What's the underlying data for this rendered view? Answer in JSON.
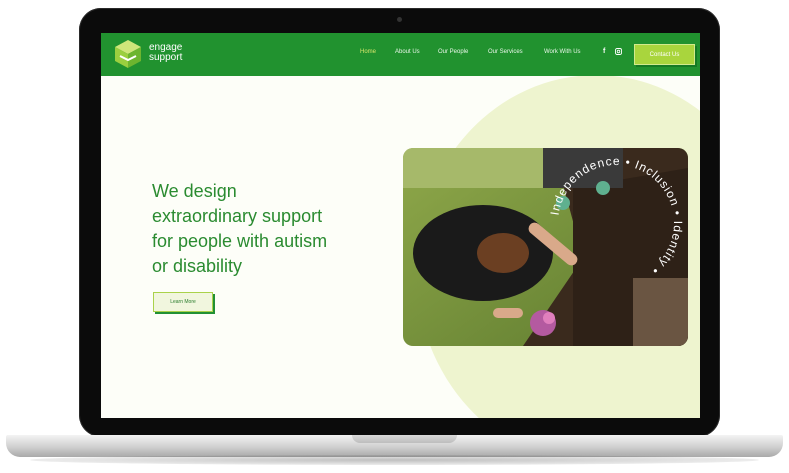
{
  "brand": {
    "line1": "engage",
    "line2": "support"
  },
  "nav": {
    "items": [
      {
        "label": "Home",
        "active": true
      },
      {
        "label": "About Us",
        "active": false
      },
      {
        "label": "Our People",
        "active": false
      },
      {
        "label": "Our Services",
        "active": false
      },
      {
        "label": "Work With Us",
        "active": false
      }
    ],
    "social": [
      "facebook-icon",
      "instagram-icon"
    ],
    "contact_label": "Contact Us"
  },
  "hero": {
    "headline_lines": [
      "We design",
      "extraordinary support",
      "for people with autism",
      "or disability"
    ],
    "cta_label": "Learn More"
  },
  "photo_ring": {
    "text": "Independence • Inclusion • Identity •"
  },
  "colors": {
    "nav_green": "#21922f",
    "accent_lime": "#a9d53d",
    "headline_green": "#2a8b30",
    "blob": "#eef4cf"
  }
}
